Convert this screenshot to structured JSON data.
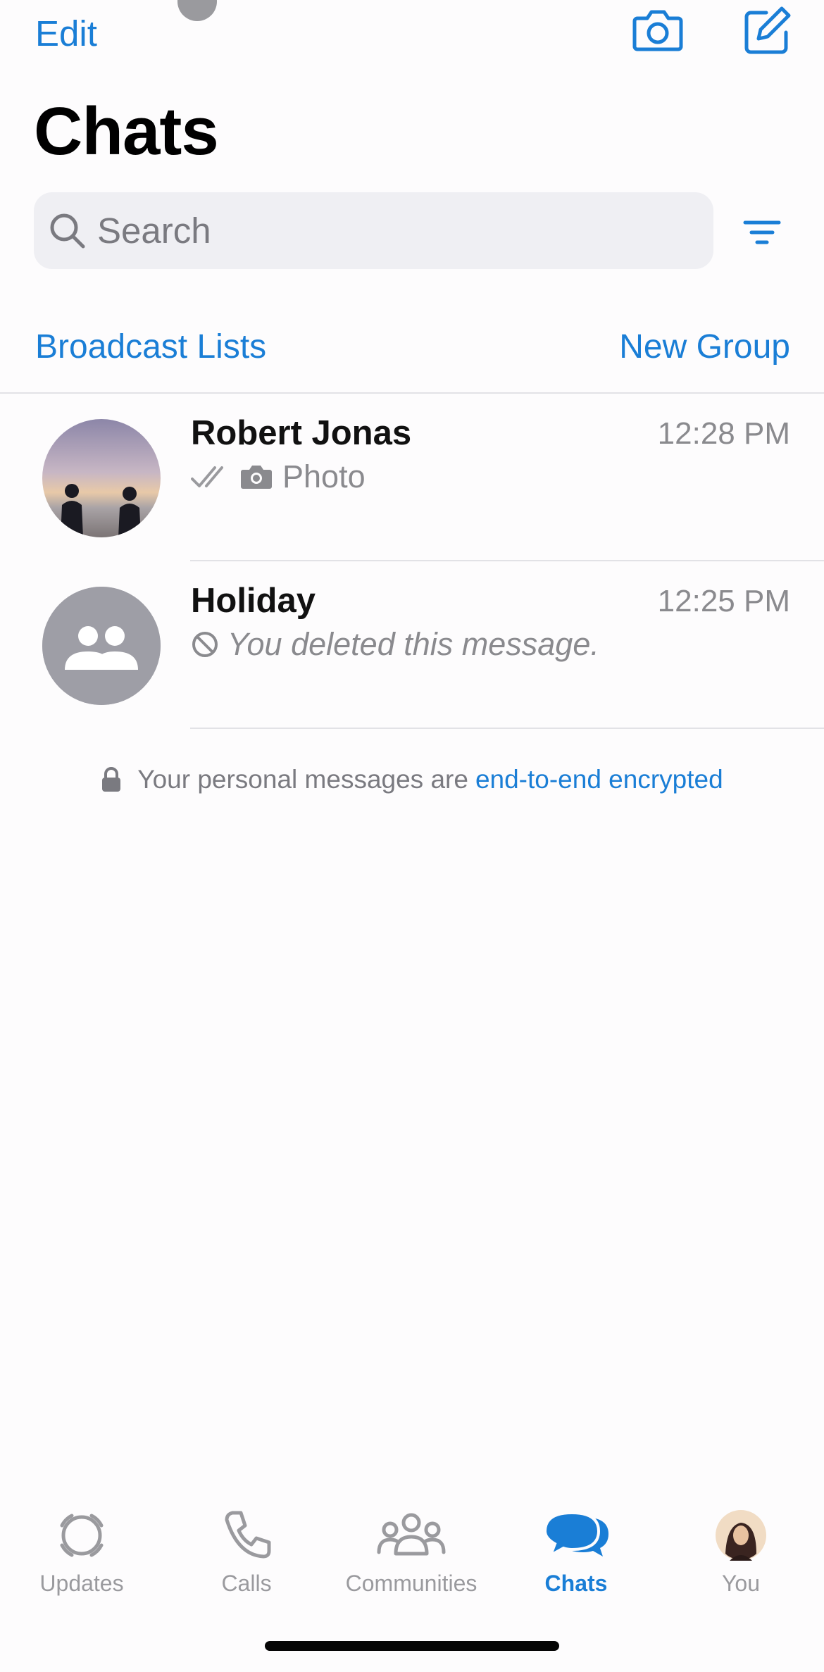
{
  "header": {
    "edit_label": "Edit",
    "title": "Chats"
  },
  "search": {
    "placeholder": "Search"
  },
  "links": {
    "broadcast": "Broadcast Lists",
    "new_group": "New Group"
  },
  "chats": [
    {
      "name": "Robert Jonas",
      "time": "12:28 PM",
      "preview": "Photo",
      "status": "read",
      "preview_icon": "camera-icon"
    },
    {
      "name": "Holiday",
      "time": "12:25 PM",
      "preview": "You deleted this message.",
      "preview_icon": "deleted-icon"
    }
  ],
  "encryption": {
    "text": "Your personal messages are",
    "link": "end-to-end encrypted"
  },
  "tabs": [
    {
      "label": "Updates",
      "icon": "updates-icon"
    },
    {
      "label": "Calls",
      "icon": "phone-icon"
    },
    {
      "label": "Communities",
      "icon": "communities-icon"
    },
    {
      "label": "Chats",
      "icon": "chats-icon",
      "active": true
    },
    {
      "label": "You",
      "icon": "avatar"
    }
  ],
  "colors": {
    "accent": "#1a7ed6",
    "secondary_text": "#8a8a8e",
    "background": "#fdfcfd"
  }
}
